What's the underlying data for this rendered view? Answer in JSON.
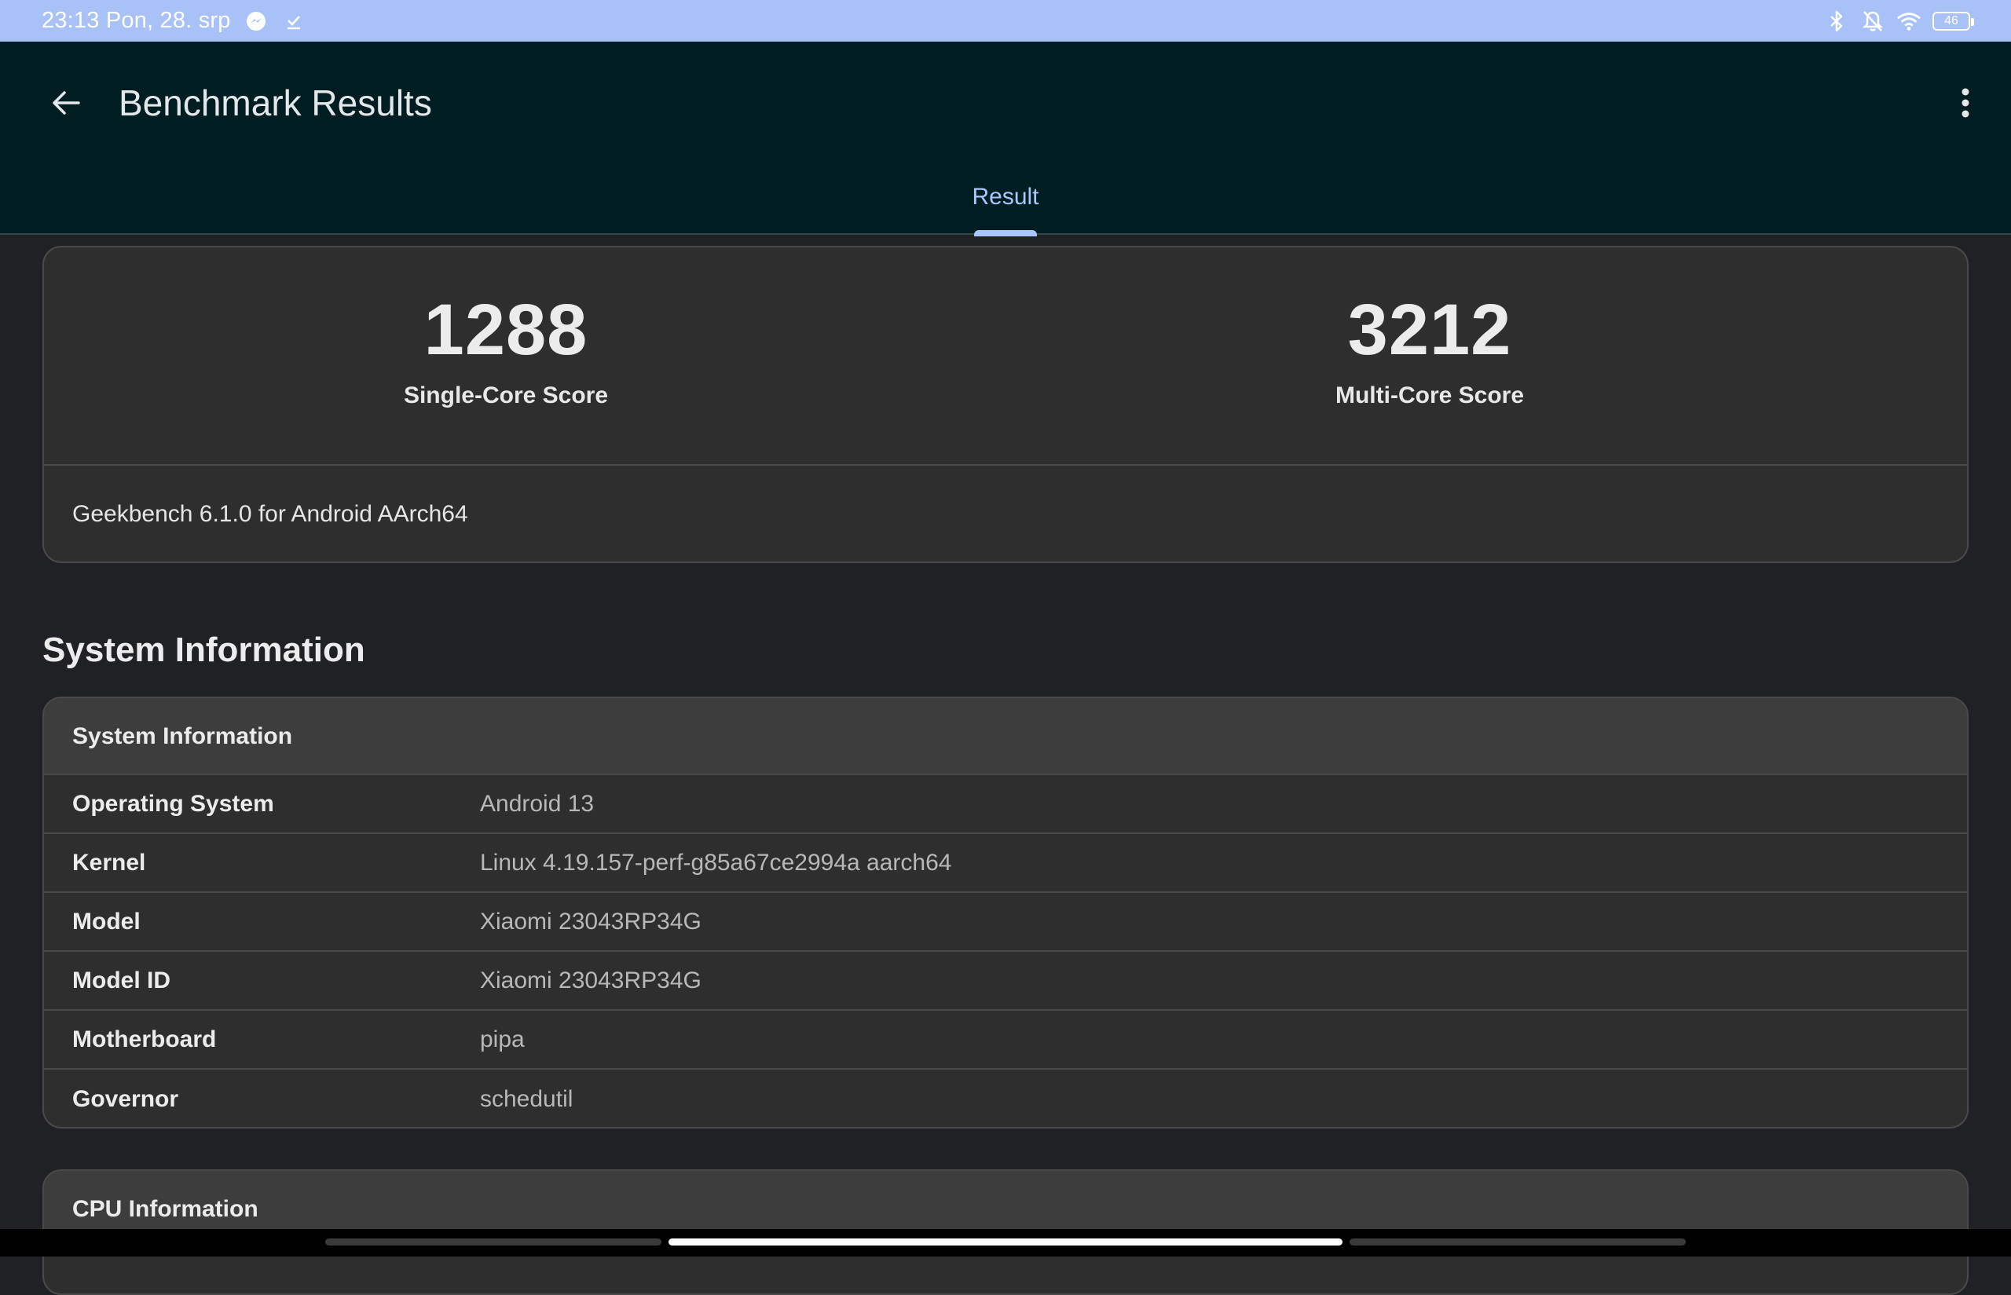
{
  "status_bar": {
    "time": "23:13 Pon, 28. srp",
    "battery": "46",
    "icons": [
      "messenger-icon",
      "download-done-icon",
      "bluetooth-icon",
      "bell-off-icon",
      "wifi-icon",
      "battery-icon"
    ]
  },
  "app_bar": {
    "title": "Benchmark Results",
    "tabs": [
      {
        "label": "Result",
        "selected": true
      }
    ]
  },
  "scores": {
    "single_value": "1288",
    "single_label": "Single-Core Score",
    "multi_value": "3212",
    "multi_label": "Multi-Core Score",
    "version": "Geekbench 6.1.0 for Android AArch64"
  },
  "system_section": {
    "title": "System Information",
    "card_title": "System Information",
    "rows": [
      {
        "key": "Operating System",
        "value": "Android 13"
      },
      {
        "key": "Kernel",
        "value": "Linux 4.19.157-perf-g85a67ce2994a aarch64"
      },
      {
        "key": "Model",
        "value": "Xiaomi 23043RP34G"
      },
      {
        "key": "Model ID",
        "value": "Xiaomi 23043RP34G"
      },
      {
        "key": "Motherboard",
        "value": "pipa"
      },
      {
        "key": "Governor",
        "value": "schedutil"
      }
    ]
  },
  "cpu_section": {
    "card_title": "CPU Information"
  },
  "colors": {
    "status_bar": "#a8c1f7",
    "app_bar": "#001e22",
    "accent": "#a9c7ff",
    "background": "#202124",
    "card": "#2e2e2e"
  }
}
